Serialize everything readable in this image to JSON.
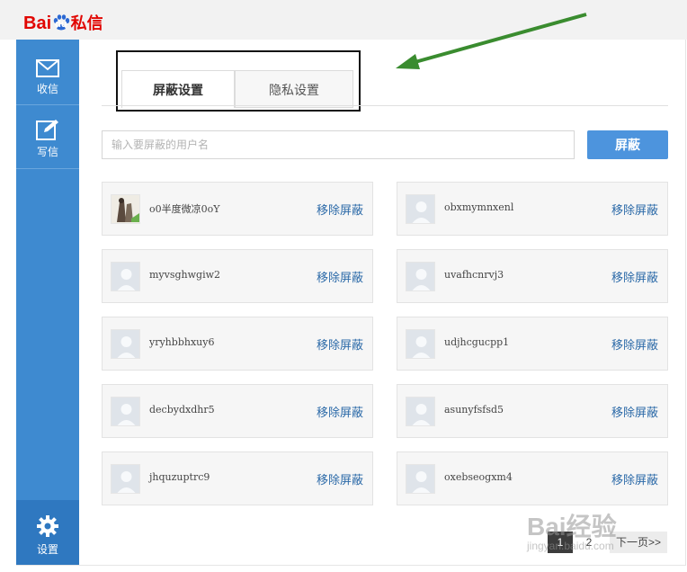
{
  "app": {
    "logo_text": "Bai",
    "logo_du": "du",
    "logo_suffix": "私信"
  },
  "sidebar": {
    "items": [
      {
        "label": "收信",
        "icon": "mail-icon"
      },
      {
        "label": "写信",
        "icon": "compose-icon"
      }
    ],
    "settings": {
      "label": "设置",
      "icon": "gear-icon"
    }
  },
  "tabs": [
    {
      "label": "屏蔽设置",
      "active": true
    },
    {
      "label": "隐私设置",
      "active": false
    }
  ],
  "search": {
    "placeholder": "输入要屏蔽的用户名",
    "button_label": "屏蔽"
  },
  "blocked_users": [
    {
      "name": "o0半度微凉0oY",
      "action": "移除屏蔽",
      "custom_avatar": true
    },
    {
      "name": "obxmymnxenl",
      "action": "移除屏蔽"
    },
    {
      "name": "myvsghwgiw2",
      "action": "移除屏蔽"
    },
    {
      "name": "uvafhcnrvj3",
      "action": "移除屏蔽"
    },
    {
      "name": "yryhbbhxuy6",
      "action": "移除屏蔽"
    },
    {
      "name": "udjhcgucpp1",
      "action": "移除屏蔽"
    },
    {
      "name": "decbydxdhr5",
      "action": "移除屏蔽"
    },
    {
      "name": "asunyfsfsd5",
      "action": "移除屏蔽"
    },
    {
      "name": "jhquzuptrc9",
      "action": "移除屏蔽"
    },
    {
      "name": "oxebseogxm4",
      "action": "移除屏蔽"
    }
  ],
  "pagination": {
    "pages": [
      "1",
      "2"
    ],
    "next": "下一页>>"
  },
  "watermark": {
    "main": "Bai经验",
    "sub": "jingyan.baidu.com"
  },
  "colors": {
    "sidebar": "#3e8ad0",
    "accent": "#4d94dd",
    "link": "#2c6aa8",
    "arrow": "#3a8c2f"
  }
}
